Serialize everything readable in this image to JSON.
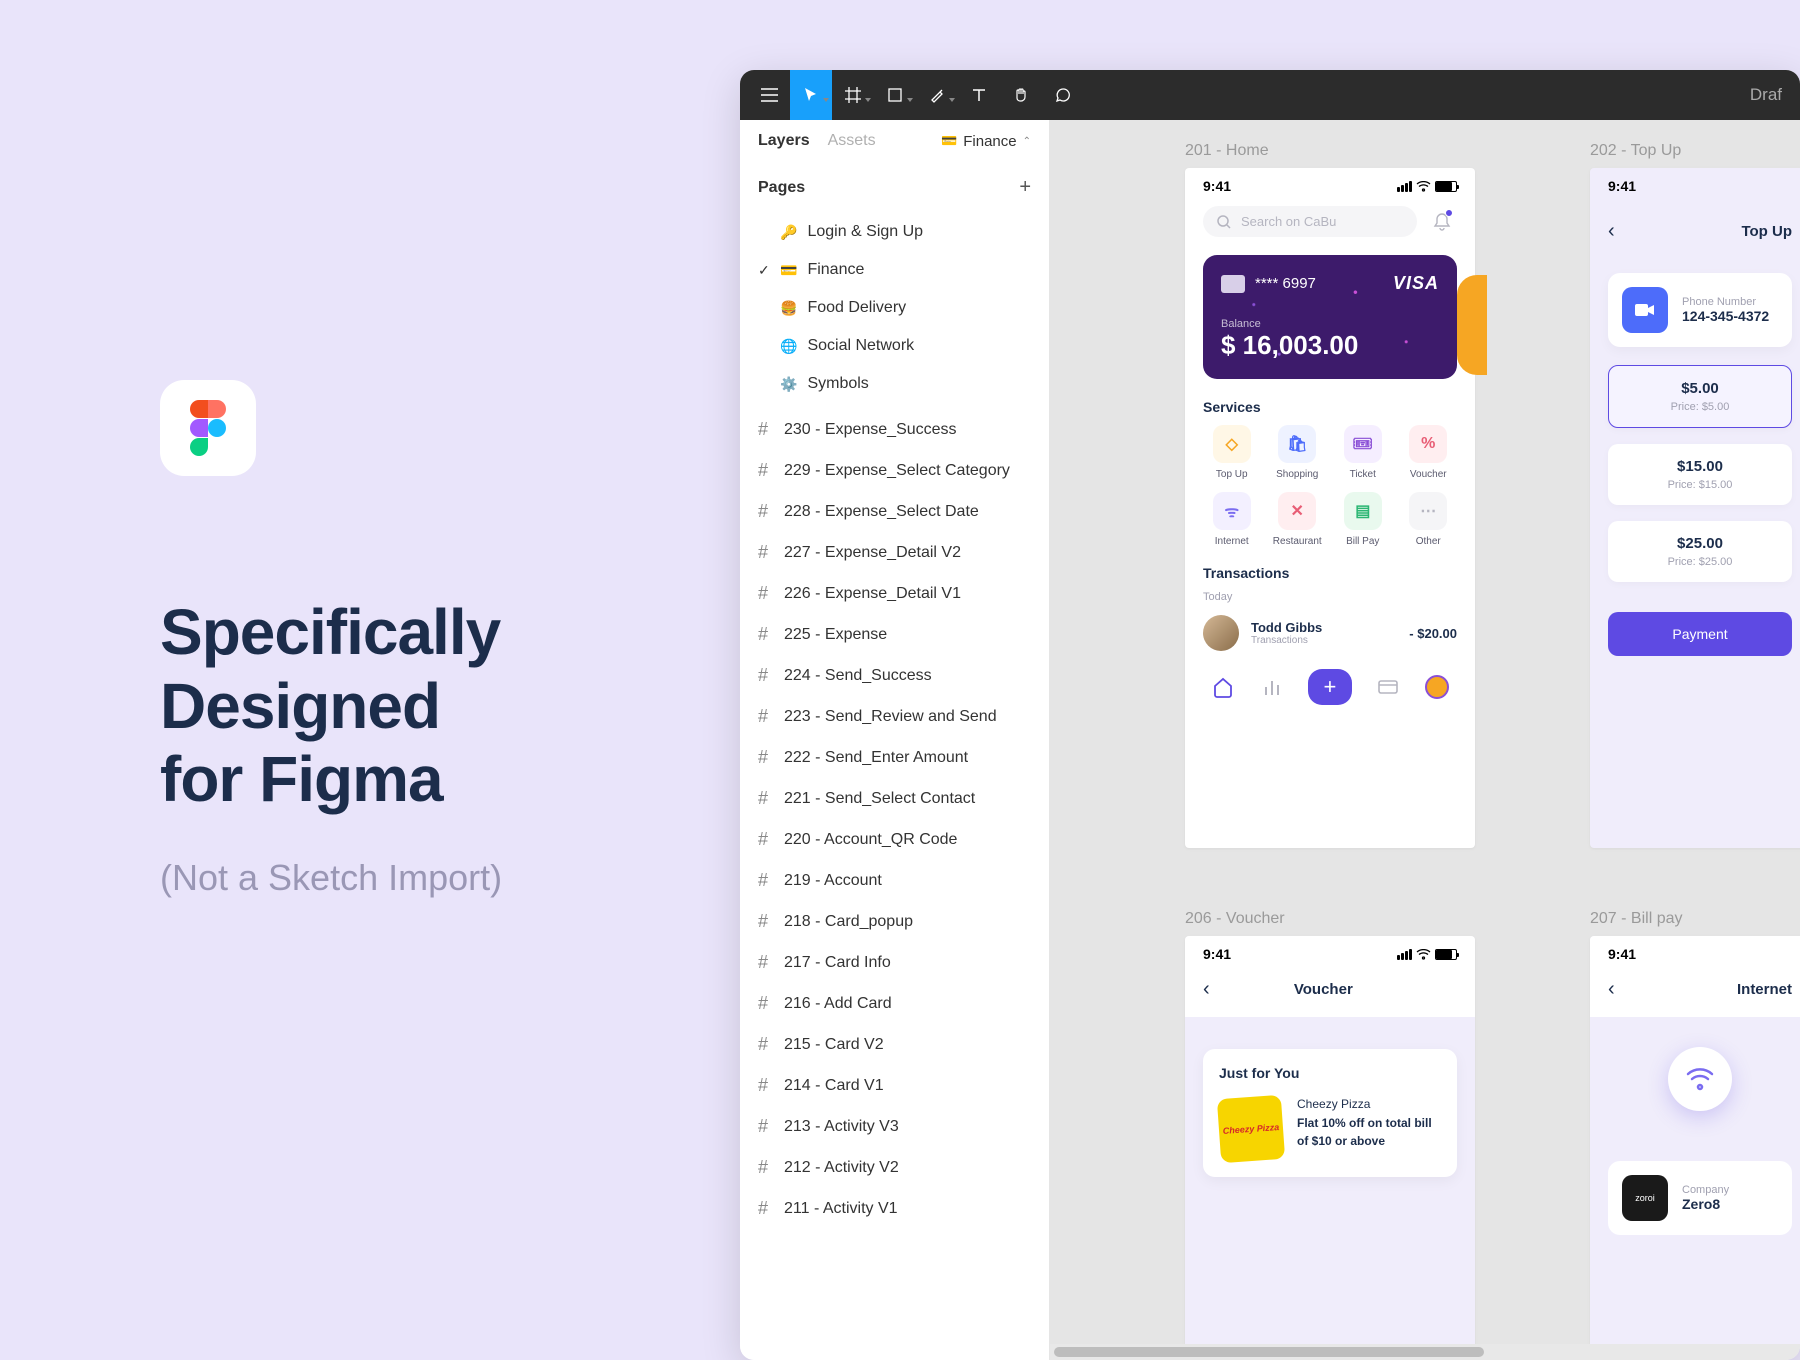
{
  "left": {
    "headline_l1": "Specifically",
    "headline_l2": "Designed",
    "headline_l3": "for Figma",
    "subtitle": "(Not a Sketch Import)"
  },
  "toolbar": {
    "right_label": "Draf"
  },
  "panel": {
    "tabs": {
      "layers": "Layers",
      "assets": "Assets"
    },
    "page_selector": "Finance",
    "pages_header": "Pages",
    "pages": [
      {
        "icon": "🔑",
        "name": "Login & Sign Up"
      },
      {
        "icon": "💳",
        "name": "Finance"
      },
      {
        "icon": "🍔",
        "name": "Food Delivery"
      },
      {
        "icon": "🌐",
        "name": "Social Network"
      },
      {
        "icon": "⚙️",
        "name": "Symbols"
      }
    ],
    "frames": [
      "230 - Expense_Success",
      "229 - Expense_Select Category",
      "228 - Expense_Select Date",
      "227 - Expense_Detail V2",
      "226 - Expense_Detail V1",
      "225 - Expense",
      "224 - Send_Success",
      "223 - Send_Review and Send",
      "222 - Send_Enter Amount",
      "221 - Send_Select Contact",
      "220 - Account_QR Code",
      "219 - Account",
      "218 - Card_popup",
      "217 - Card Info",
      "216 - Add Card",
      "215 - Card V2",
      "214 - Card V1",
      "213 - Activity V3",
      "212 - Activity V2",
      "211 - Activity V1"
    ]
  },
  "artboards": {
    "a1_label": "201 - Home",
    "a2_label": "202 - Top Up",
    "a3_label": "206 - Voucher",
    "a4_label": "207 - Bill pay"
  },
  "status_time": "9:41",
  "home": {
    "search_placeholder": "Search on CaBu",
    "card_number": "**** 6997",
    "card_brand": "VISA",
    "balance_label": "Balance",
    "balance": "$ 16,003.00",
    "services_title": "Services",
    "services": [
      {
        "label": "Top Up",
        "bg": "#FFF7E6",
        "fg": "#F6A623",
        "glyph": "◇"
      },
      {
        "label": "Shopping",
        "bg": "#EEF2FF",
        "fg": "#4D6CFA",
        "glyph": "🛍"
      },
      {
        "label": "Ticket",
        "bg": "#F5EEFF",
        "fg": "#8A4FD6",
        "glyph": "🎟"
      },
      {
        "label": "Voucher",
        "bg": "#FFEEF0",
        "fg": "#E85D75",
        "glyph": "%"
      },
      {
        "label": "Internet",
        "bg": "#F3F0FF",
        "fg": "#7A6CF0",
        "glyph": "ᯤ"
      },
      {
        "label": "Restaurant",
        "bg": "#FFEEF0",
        "fg": "#E85D75",
        "glyph": "✕"
      },
      {
        "label": "Bill Pay",
        "bg": "#E9F9EE",
        "fg": "#2BB673",
        "glyph": "▤"
      },
      {
        "label": "Other",
        "bg": "#F5F5F7",
        "fg": "#B5B5C0",
        "glyph": "⋯"
      }
    ],
    "tx_title": "Transactions",
    "tx_today": "Today",
    "tx_name": "Todd Gibbs",
    "tx_sub": "Transactions",
    "tx_amt": "- $20.00"
  },
  "topup": {
    "title": "Top Up",
    "phone_label": "Phone Number",
    "phone_number": "124-345-4372",
    "amounts": [
      {
        "val": "$5.00",
        "price": "Price: $5.00",
        "selected": true
      },
      {
        "val": "$15.00",
        "price": "Price: $15.00",
        "selected": false
      },
      {
        "val": "$25.00",
        "price": "Price: $25.00",
        "selected": false
      }
    ],
    "pay_btn": "Payment"
  },
  "voucher": {
    "title": "Voucher",
    "section": "Just for You",
    "item_title": "Cheezy Pizza",
    "item_desc": "Flat 10% off on total bill of $10 or above",
    "pizza_logo": "Cheezy Pizza"
  },
  "billpay": {
    "title": "Internet",
    "company_label": "Company",
    "company_name": "Zero8",
    "company_logo": "zoroi"
  }
}
